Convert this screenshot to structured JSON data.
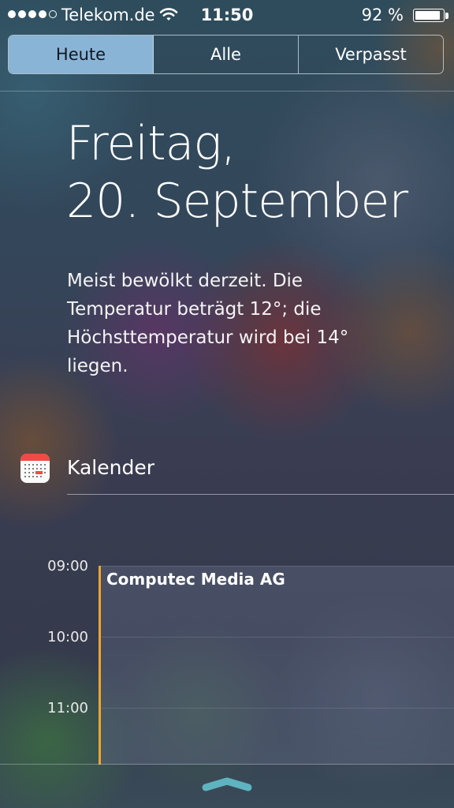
{
  "status_bar": {
    "carrier": "Telekom.de",
    "time": "11:50",
    "battery_percent": "92 %",
    "signal_bars": 4,
    "battery_level": 0.92
  },
  "tabs": [
    {
      "label": "Heute",
      "active": true
    },
    {
      "label": "Alle",
      "active": false
    },
    {
      "label": "Verpasst",
      "active": false
    }
  ],
  "today": {
    "weekday": "Freitag,",
    "date": "20. September",
    "weather_lines": [
      "Meist bewölkt derzeit. Die",
      "Temperatur beträgt 12°; die",
      "Höchsttemperatur wird bei 14°",
      "liegen."
    ]
  },
  "calendar": {
    "title": "Kalender",
    "times": [
      "09:00",
      "10:00",
      "11:00"
    ],
    "event": {
      "title": "Computec Media AG",
      "color": "#f0a52a"
    }
  },
  "colors": {
    "active_tab": "#8ab4d6",
    "calendar_red": "#f04a44"
  },
  "icons": {
    "wifi": "wifi-icon",
    "battery": "battery-icon",
    "calendar": "calendar-app-icon",
    "grabber": "grabber-icon"
  }
}
